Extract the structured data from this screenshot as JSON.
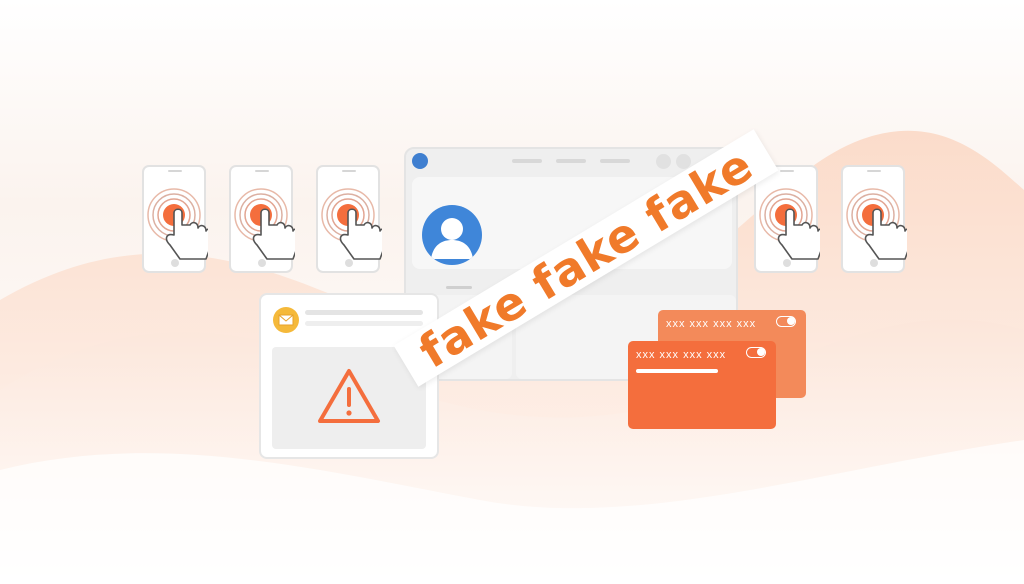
{
  "banner": {
    "words": [
      "fake",
      "fake",
      "fake"
    ]
  },
  "phones": [
    {
      "name": "phone-1",
      "icon": "tap-hand-icon"
    },
    {
      "name": "phone-2",
      "icon": "tap-hand-icon"
    },
    {
      "name": "phone-3",
      "icon": "tap-hand-icon"
    },
    {
      "name": "phone-4",
      "icon": "tap-hand-icon"
    },
    {
      "name": "phone-5",
      "icon": "tap-hand-icon"
    }
  ],
  "email_card": {
    "icon": "envelope-icon",
    "warning_icon": "warning-triangle-icon"
  },
  "cards": {
    "back_number": "xxx xxx xxx xxx",
    "front_number": "xxx xxx xxx xxx"
  },
  "browser": {
    "avatar_icon": "user-avatar-icon"
  },
  "colors": {
    "accent": "#f46e3d",
    "banner_text": "#f07a2a",
    "avatar": "#3f86d9",
    "mail": "#f5b93a",
    "background_wave": "#fbe3d6"
  }
}
